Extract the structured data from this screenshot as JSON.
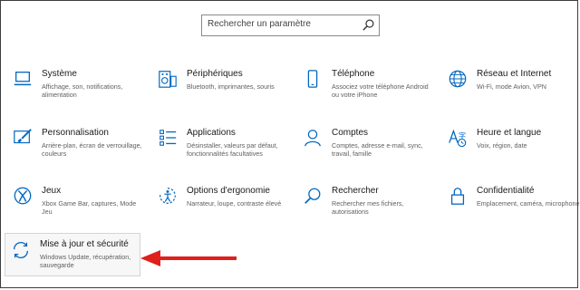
{
  "search": {
    "placeholder": "Rechercher un paramètre"
  },
  "settings": [
    {
      "title": "Système",
      "desc": "Affichage, son, notifications, alimentation",
      "icon": "laptop-icon"
    },
    {
      "title": "Périphériques",
      "desc": "Bluetooth, imprimantes, souris",
      "icon": "keyboard-speaker-icon"
    },
    {
      "title": "Téléphone",
      "desc": "Associez votre téléphone Android ou votre iPhone",
      "icon": "phone-icon"
    },
    {
      "title": "Réseau et Internet",
      "desc": "Wi-Fi, mode Avion, VPN",
      "icon": "globe-icon"
    },
    {
      "title": "Personnalisation",
      "desc": "Arrière-plan, écran de verrouillage, couleurs",
      "icon": "paint-brush-icon"
    },
    {
      "title": "Applications",
      "desc": "Désinstaller, valeurs par défaut, fonctionnalités facultatives",
      "icon": "app-list-icon"
    },
    {
      "title": "Comptes",
      "desc": "Comptes, adresse e-mail, sync, travail, famille",
      "icon": "person-icon"
    },
    {
      "title": "Heure et langue",
      "desc": "Voix, région, date",
      "icon": "time-language-icon"
    },
    {
      "title": "Jeux",
      "desc": "Xbox Game Bar, captures, Mode Jeu",
      "icon": "xbox-icon"
    },
    {
      "title": "Options d'ergonomie",
      "desc": "Narrateur, loupe, contraste élevé",
      "icon": "ease-of-access-icon"
    },
    {
      "title": "Rechercher",
      "desc": "Rechercher mes fichiers, autorisations",
      "icon": "search-icon"
    },
    {
      "title": "Confidentialité",
      "desc": "Emplacement, caméra, microphone",
      "icon": "lock-icon"
    },
    {
      "title": "Mise à jour et sécurité",
      "desc": "Windows Update, récupération, sauvegarde",
      "icon": "sync-icon"
    }
  ],
  "colors": {
    "accent": "#0067c0",
    "annotation_arrow": "#e0201b"
  }
}
